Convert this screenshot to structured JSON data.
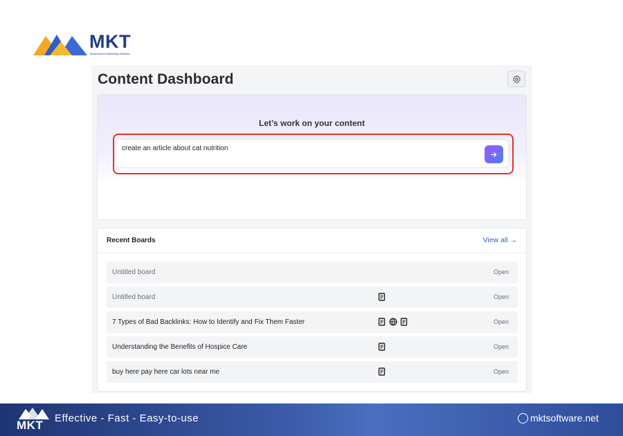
{
  "brand": {
    "wordmark": "MKT",
    "tagline": "Multichannel Marketing Software",
    "colors": {
      "navy": "#1f3d8a",
      "orange": "#f5a623",
      "accent": "#e0342a"
    }
  },
  "header": {
    "title": "Content Dashboard",
    "settings_icon": "gear-icon"
  },
  "prompt": {
    "heading": "Let’s work on your content",
    "input_value": "create an article about cat nutrition",
    "send_icon": "arrow-right-icon"
  },
  "recent_boards": {
    "title": "Recent Boards",
    "view_all": "View all →",
    "rows": [
      {
        "name": "Untitled board",
        "muted": true,
        "icons": [],
        "action": "Open"
      },
      {
        "name": "Untitled board",
        "muted": true,
        "icons": [
          "document-icon"
        ],
        "action": "Open"
      },
      {
        "name": "7 Types of Bad Backlinks: How to Identify and Fix Them Faster",
        "muted": false,
        "icons": [
          "document-icon",
          "globe-icon",
          "document-icon"
        ],
        "action": "Open"
      },
      {
        "name": "Understanding the Benefits of Hospice Care",
        "muted": false,
        "icons": [
          "document-icon"
        ],
        "action": "Open"
      },
      {
        "name": "buy here pay here car lots near me",
        "muted": false,
        "icons": [
          "document-icon"
        ],
        "action": "Open"
      }
    ]
  },
  "footer": {
    "wordmark": "MKT",
    "slogan": "Effective - Fast - Easy-to-use",
    "site": "mktsoftware.net"
  }
}
